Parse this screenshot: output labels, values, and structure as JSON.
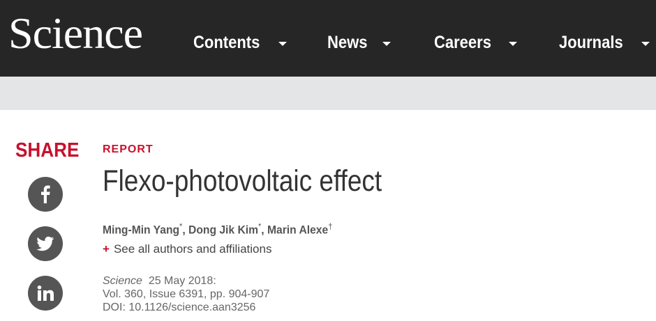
{
  "header": {
    "logo": "Science",
    "nav": [
      {
        "label": "Contents"
      },
      {
        "label": "News"
      },
      {
        "label": "Careers"
      },
      {
        "label": "Journals"
      }
    ]
  },
  "share": {
    "label": "SHARE",
    "icons": [
      "facebook-icon",
      "twitter-icon",
      "linkedin-icon"
    ]
  },
  "article": {
    "kicker": "REPORT",
    "title": "Flexo-photovoltaic effect",
    "authors": [
      {
        "name": "Ming-Min Yang",
        "mark": "*"
      },
      {
        "name": "Dong Jik Kim",
        "mark": "*"
      },
      {
        "name": "Marin Alexe",
        "mark": "†"
      }
    ],
    "author_sep": ", ",
    "see_all_plus": "+",
    "see_all": "See all authors and affiliations",
    "citation": {
      "journal": "Science",
      "date": "25 May 2018:",
      "volume": "Vol. 360, Issue 6391, pp. 904-907",
      "doi": "DOI: 10.1126/science.aan3256"
    }
  },
  "colors": {
    "header_bg": "#262626",
    "subbar_bg": "#e3e5e6",
    "accent_red": "#c8102e",
    "social_bg": "#555555"
  }
}
